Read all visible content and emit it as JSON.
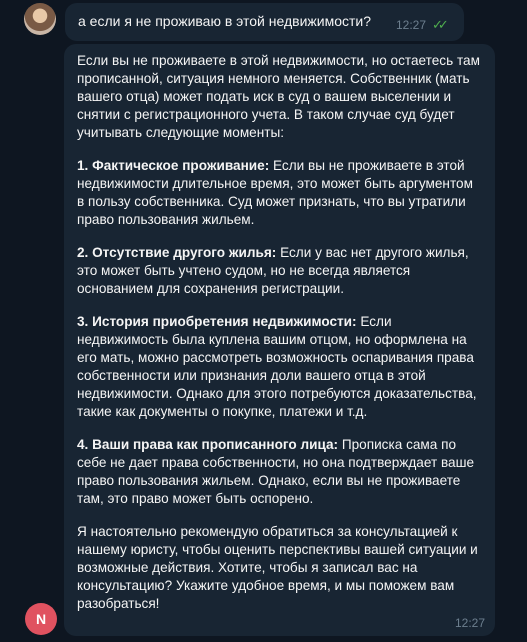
{
  "user_message": {
    "text": "а если я не проживаю в этой недвижимости?",
    "time": "12:27",
    "status_icon": "double-check-icon",
    "status_color": "#4fae4e"
  },
  "bot_message": {
    "intro": "Если вы не проживаете в этой недвижимости, но остаетесь там прописанной, ситуация немного меняется. Собственник (мать вашего отца) может подать иск в суд о вашем выселении и снятии с регистрационного учета. В таком случае суд будет учитывать следующие моменты:",
    "points": [
      {
        "title": "1. Фактическое проживание:",
        "text": " Если вы не проживаете в этой недвижимости длительное время, это может быть аргументом в пользу собственника. Суд может признать, что вы утратили право пользования жильем."
      },
      {
        "title": "2. Отсутствие другого жилья:",
        "text": " Если у вас нет другого жилья, это может быть учтено судом, но не всегда является основанием для сохранения регистрации."
      },
      {
        "title": "3. История приобретения недвижимости:",
        "text": " Если недвижимость была куплена вашим отцом, но оформлена на его мать, можно рассмотреть возможность оспаривания права собственности или признания доли вашего отца в этой недвижимости. Однако для этого потребуются доказательства, такие как документы о покупке, платежи и т.д."
      },
      {
        "title": "4. Ваши права как прописанного лица:",
        "text": " Прописка сама по себе не дает права собственности, но она подтверждает ваше право пользования жильем. Однако, если вы не проживаете там, это право может быть оспорено."
      }
    ],
    "outro": "Я настоятельно рекомендую обратиться за консультацией к нашему юристу, чтобы оценить перспективы вашей ситуации и возможные действия. Хотите, чтобы я записал вас на консультацию? Укажите удобное время, и мы поможем вам разобраться!",
    "time": "12:27",
    "sender_initial": "N",
    "avatar_color": "#e05260"
  },
  "colors": {
    "background": "#0e1621",
    "bubble": "#182533",
    "meta_text": "#6d7f8f"
  }
}
